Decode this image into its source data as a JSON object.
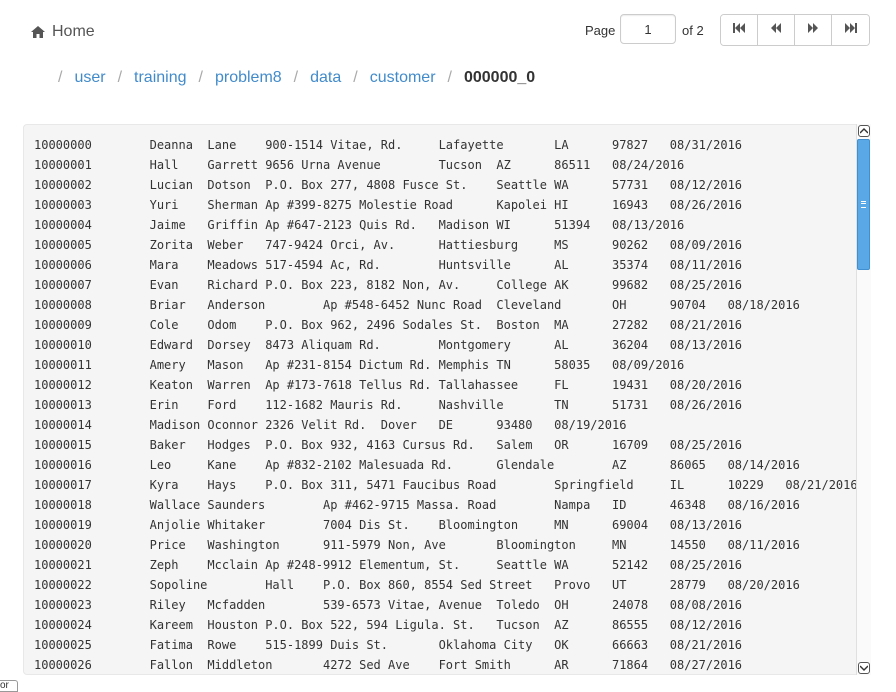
{
  "header": {
    "home_label": "Home",
    "home_icon": "home-icon"
  },
  "pager": {
    "page_label": "Page",
    "page_value": "1",
    "of_label": "of 2",
    "buttons": [
      "first-page-icon",
      "previous-page-icon",
      "next-page-icon",
      "last-page-icon"
    ]
  },
  "breadcrumb": {
    "items": [
      "user",
      "training",
      "problem8",
      "data",
      "customer"
    ],
    "current": "000000_0"
  },
  "file": {
    "lines": [
      "10000000\tDeanna\tLane\t900-1514 Vitae, Rd.\tLafayette\tLA\t97827\t08/31/2016",
      "10000001\tHall\tGarrett\t9656 Urna Avenue\tTucson\tAZ\t86511\t08/24/2016",
      "10000002\tLucian\tDotson\tP.O. Box 277, 4808 Fusce St.\tSeattle\tWA\t57731\t08/12/2016",
      "10000003\tYuri\tSherman\tAp #399-8275 Molestie Road\tKapolei\tHI\t16943\t08/26/2016",
      "10000004\tJaime\tGriffin\tAp #647-2123 Quis Rd.\tMadison\tWI\t51394\t08/13/2016",
      "10000005\tZorita\tWeber\t747-9424 Orci, Av.\tHattiesburg\tMS\t90262\t08/09/2016",
      "10000006\tMara\tMeadows\t517-4594 Ac, Rd.\tHuntsville\tAL\t35374\t08/11/2016",
      "10000007\tEvan\tRichard\tP.O. Box 223, 8182 Non, Av.\tCollege\tAK\t99682\t08/25/2016",
      "10000008\tBriar\tAnderson\tAp #548-6452 Nunc Road\tCleveland\tOH\t90704\t08/18/2016",
      "10000009\tCole\tOdom\tP.O. Box 962, 2496 Sodales St.\tBoston\tMA\t27282\t08/21/2016",
      "10000010\tEdward\tDorsey\t8473 Aliquam Rd.\tMontgomery\tAL\t36204\t08/13/2016",
      "10000011\tAmery\tMason\tAp #231-8154 Dictum Rd.\tMemphis\tTN\t58035\t08/09/2016",
      "10000012\tKeaton\tWarren\tAp #173-7618 Tellus Rd.\tTallahassee\tFL\t19431\t08/20/2016",
      "10000013\tErin\tFord\t112-1682 Mauris Rd.\tNashville\tTN\t51731\t08/26/2016",
      "10000014\tMadison\tOconnor\t2326 Velit Rd.\tDover\tDE\t93480\t08/19/2016",
      "10000015\tBaker\tHodges\tP.O. Box 932, 4163 Cursus Rd.\tSalem\tOR\t16709\t08/25/2016",
      "10000016\tLeo\tKane\tAp #832-2102 Malesuada Rd.\tGlendale\tAZ\t86065\t08/14/2016",
      "10000017\tKyra\tHays\tP.O. Box 311, 5471 Faucibus Road\tSpringfield\tIL\t10229\t08/21/2016",
      "10000018\tWallace\tSaunders\tAp #462-9715 Massa. Road\tNampa\tID\t46348\t08/16/2016",
      "10000019\tAnjolie\tWhitaker\t7004 Dis St.\tBloomington\tMN\t69004\t08/13/2016",
      "10000020\tPrice\tWashington\t911-5979 Non, Ave\tBloomington\tMN\t14550\t08/11/2016",
      "10000021\tZeph\tMcclain\tAp #248-9912 Elementum, St.\tSeattle\tWA\t52142\t08/25/2016",
      "10000022\tSopoline\tHall\tP.O. Box 860, 8554 Sed Street\tProvo\tUT\t28779\t08/20/2016",
      "10000023\tRiley\tMcfadden\t539-6573 Vitae, Avenue\tToledo\tOH\t24078\t08/08/2016",
      "10000024\tKareem\tHouston\tP.O. Box 522, 594 Ligula. St.\tTucson\tAZ\t86555\t08/12/2016",
      "10000025\tFatima\tRowe\t515-1899 Duis St.\tOklahoma City\tOK\t66663\t08/21/2016",
      "10000026\tFallon\tMiddleton\t4272 Sed Ave\tFort Smith\tAR\t71864\t08/27/2016"
    ]
  },
  "footer_stub": "or",
  "colors": {
    "link": "#428bca",
    "scroll_thumb": "#5aa9e6",
    "panel_bg": "#f5f5f5"
  }
}
